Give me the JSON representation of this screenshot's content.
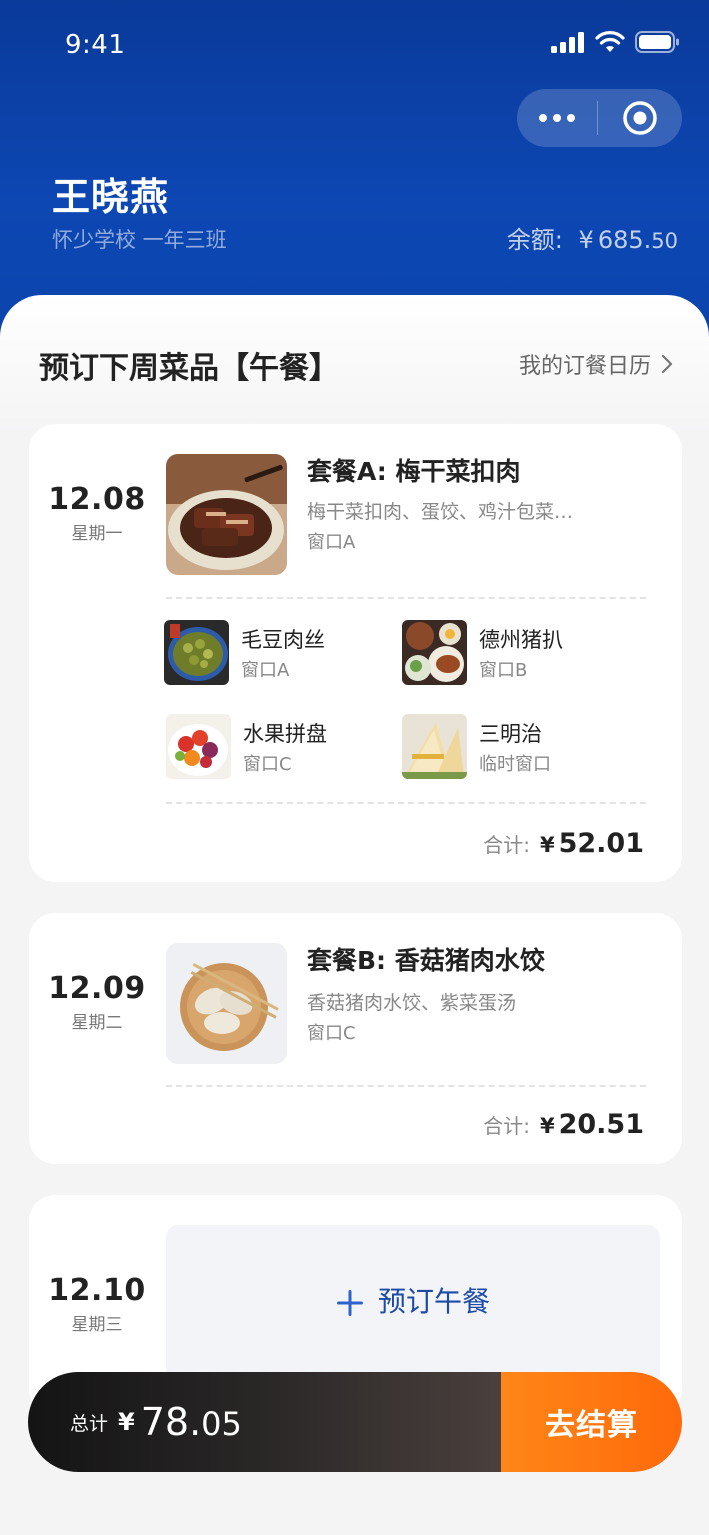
{
  "status_bar": {
    "time": "9:41"
  },
  "capsule": {
    "more_icon": "more-dots-icon",
    "close_icon": "target-circle-icon"
  },
  "header": {
    "name": "王晓燕",
    "school": "怀少学校 一年三班",
    "balance_label": "余额:",
    "balance_yen": "¥",
    "balance_int": "685.",
    "balance_dec": "50"
  },
  "section": {
    "title": "预订下周菜品【午餐】",
    "calendar_link": "我的订餐日历"
  },
  "days": [
    {
      "date": "12.08",
      "weekday": "星期一",
      "main": {
        "title": "套餐A: 梅干菜扣肉",
        "desc": "梅干菜扣肉、蛋饺、鸡汁包菜…",
        "window": "窗口A"
      },
      "sides": [
        {
          "name": "毛豆肉丝",
          "window": "窗口A"
        },
        {
          "name": "德州猪扒",
          "window": "窗口B"
        },
        {
          "name": "水果拼盘",
          "window": "窗口C"
        },
        {
          "name": "三明治",
          "window": "临时窗口"
        }
      ],
      "subtotal_label": "合计:",
      "subtotal_yen": "¥",
      "subtotal": "52.01"
    },
    {
      "date": "12.09",
      "weekday": "星期二",
      "main": {
        "title": "套餐B: 香菇猪肉水饺",
        "desc": "香菇猪肉水饺、紫菜蛋汤",
        "window": "窗口C"
      },
      "subtotal_label": "合计:",
      "subtotal_yen": "¥",
      "subtotal": "20.51"
    },
    {
      "date": "12.10",
      "weekday": "星期三",
      "reserve_label": "预订午餐"
    }
  ],
  "bottom": {
    "total_label": "总计",
    "total_yen": "¥",
    "total_int": "78.",
    "total_dec": "05",
    "checkout": "去结算"
  },
  "colors": {
    "header_blue": "#0d47b3",
    "checkout_orange": "#ff7a12",
    "link_blue": "#1c4aa6"
  }
}
